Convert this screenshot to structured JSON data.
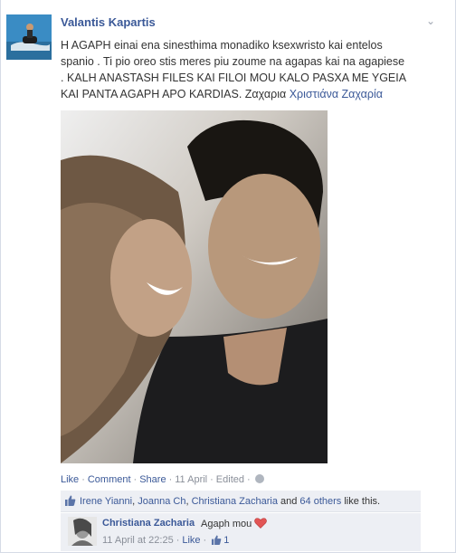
{
  "post": {
    "author": "Valantis Kapartis",
    "text_lines": [
      "H AGAPH einai ena sinesthima monadiko ksexwristo kai entelos",
      "spanio . Ti pio oreo stis meres piu zoume na agapas kai na agapiese",
      ". KALH ANASTASH FILES KAI FILOI MOU KALO PASXA ME YGEIA"
    ],
    "last_line_text": "KAI PANTA AGAPH APO KARDIAS. Ζαχαρια ",
    "mention": "Χριστιάνα Ζαχαρία",
    "menu_icon": "chevron-down-icon"
  },
  "actions": {
    "like": "Like",
    "comment": "Comment",
    "share": "Share",
    "date": "11 April",
    "edited": "Edited",
    "privacy_icon": "globe-icon"
  },
  "likes": {
    "names": [
      "Irene Yianni",
      "Joanna Ch",
      "Christiana Zacharia"
    ],
    "sep1": ", ",
    "sep2": ", ",
    "and": " and ",
    "others": "64 others",
    "suffix": " like this."
  },
  "comment": {
    "author": "Christiana Zacharia",
    "text": "Agaph mou",
    "time": "11 April at 22:25",
    "like": "Like",
    "like_count": "1"
  },
  "colors": {
    "link": "#3b5998",
    "ufi_background": "#edeff4",
    "meta_text": "#8a8f99"
  }
}
